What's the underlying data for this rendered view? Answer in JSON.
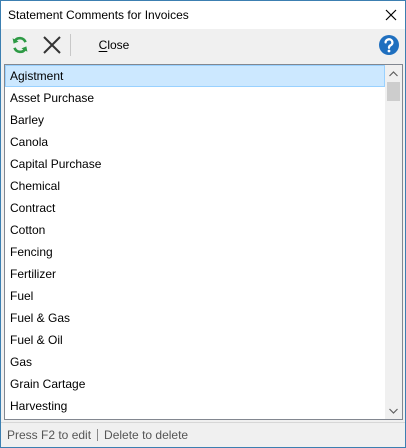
{
  "window": {
    "title": "Statement Comments for Invoices"
  },
  "toolbar": {
    "close_mnemonic": "C",
    "close_rest": "lose",
    "refresh_icon": "refresh-icon",
    "cancel_icon": "x-icon",
    "help_icon": "help-icon"
  },
  "list": {
    "selected_index": 0,
    "items": [
      "Agistment",
      "Asset Purchase",
      "Barley",
      "Canola",
      "Capital Purchase",
      "Chemical",
      "Contract",
      "Cotton",
      "Fencing",
      "Fertilizer",
      "Fuel",
      "Fuel & Gas",
      "Fuel & Oil",
      "Gas",
      "Grain Cartage",
      "Harvesting"
    ]
  },
  "status": {
    "edit_hint": "Press F2 to edit",
    "delete_hint": "Delete to delete"
  },
  "colors": {
    "accent": "#3c7fb1",
    "selection_bg": "#cce8ff",
    "selection_border": "#99d1ff",
    "refresh_green": "#2e9a45",
    "help_blue": "#1f6fbf"
  }
}
